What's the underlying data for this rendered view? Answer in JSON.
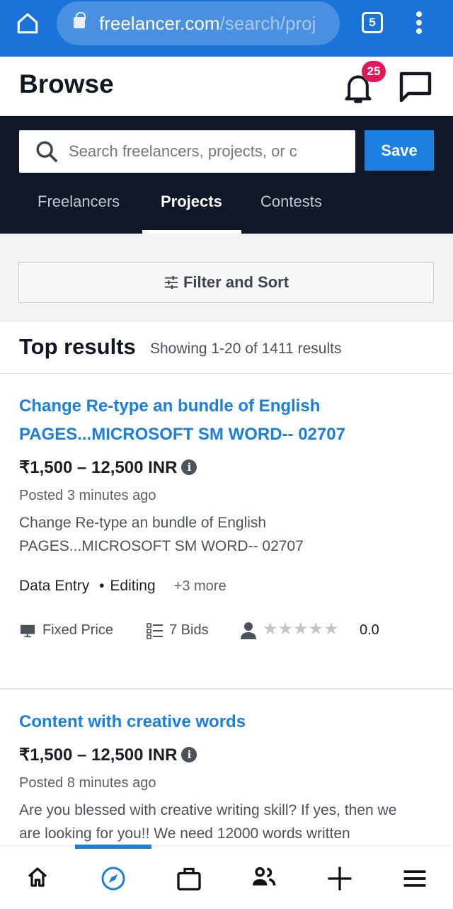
{
  "browser": {
    "url_domain": "freelancer.com",
    "url_path": "/search/proj",
    "tab_count": "5"
  },
  "header": {
    "title": "Browse",
    "notification_count": "25"
  },
  "search": {
    "placeholder": "Search freelancers, projects, or c",
    "save_label": "Save"
  },
  "tabs": [
    {
      "label": "Freelancers"
    },
    {
      "label": "Projects",
      "active": true
    },
    {
      "label": "Contests"
    }
  ],
  "filter": {
    "label": "Filter and Sort"
  },
  "results": {
    "heading": "Top results",
    "summary": "Showing 1-20 of 1411 results"
  },
  "projects": [
    {
      "title": "Change Re-type an bundle of English PAGES...MICROSOFT SM WORD-- 02707",
      "price": "₹1,500 – 12,500 INR",
      "posted": "Posted 3 minutes ago",
      "description": "Change Re-type an bundle of English PAGES...MICROSOFT SM WORD-- 02707",
      "skills": [
        "Data Entry",
        "Editing"
      ],
      "more": "+3 more",
      "type": "Fixed Price",
      "bids": "7 Bids",
      "rating": "0.0"
    },
    {
      "title": "Content with creative words",
      "price": "₹1,500 – 12,500 INR",
      "posted": "Posted 8 minutes ago",
      "description": "Are you blessed with creative writing skill? If yes, then we are looking for you!! We need 12000 words written"
    }
  ],
  "colors": {
    "accent": "#1a7fe0",
    "browser_bar": "#1a73d9",
    "dark_bar": "#101827",
    "badge": "#e0195a"
  },
  "bottom_nav": [
    "home-icon",
    "browse-compass-icon",
    "projects-briefcase-icon",
    "contacts-icon",
    "post-plus-icon",
    "menu-icon"
  ]
}
